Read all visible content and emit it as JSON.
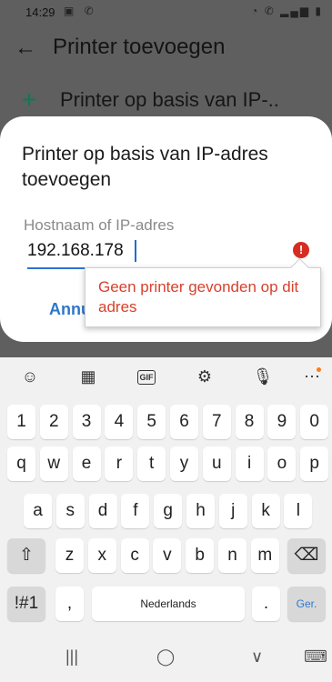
{
  "statusbar": {
    "time": "14:29",
    "left_icons": "▣ ✆",
    "right_icons": "◔ ✆ ▂▄▆ ▮"
  },
  "appbar": {
    "title": "Printer toevoegen"
  },
  "add_row": {
    "label": "Printer op basis van IP-.."
  },
  "dialog": {
    "title": "Printer op basis van IP-adres toevoegen",
    "field_label": "Hostnaam of IP-adres",
    "field_value": "192.168.178",
    "cancel_label": "Annu",
    "error_icon": "!"
  },
  "tooltip": {
    "text": "Geen printer gevonden op dit adres"
  },
  "keyboard": {
    "toolbar": {
      "emoji": "☺",
      "sticker": "▦",
      "gif": "GIF",
      "settings": "⚙",
      "mic": "🎙",
      "more": "⋯"
    },
    "row_numbers": [
      "1",
      "2",
      "3",
      "4",
      "5",
      "6",
      "7",
      "8",
      "9",
      "0"
    ],
    "row1": [
      "q",
      "w",
      "e",
      "r",
      "t",
      "y",
      "u",
      "i",
      "o",
      "p"
    ],
    "row2": [
      "a",
      "s",
      "d",
      "f",
      "g",
      "h",
      "j",
      "k",
      "l"
    ],
    "row3": [
      "z",
      "x",
      "c",
      "v",
      "b",
      "n",
      "m"
    ],
    "shift": "⇧",
    "backspace": "⌫",
    "symbols": "!#1",
    "comma": ",",
    "space": "Nederlands",
    "period": ".",
    "enter": "Ger."
  },
  "navbar": {
    "recents": "|||",
    "home": "◯",
    "back": "∨",
    "keyboard_hide": "⌨"
  },
  "colors": {
    "accent": "#2e76c9",
    "error": "#d62d20",
    "plus": "#0a7a5a"
  }
}
